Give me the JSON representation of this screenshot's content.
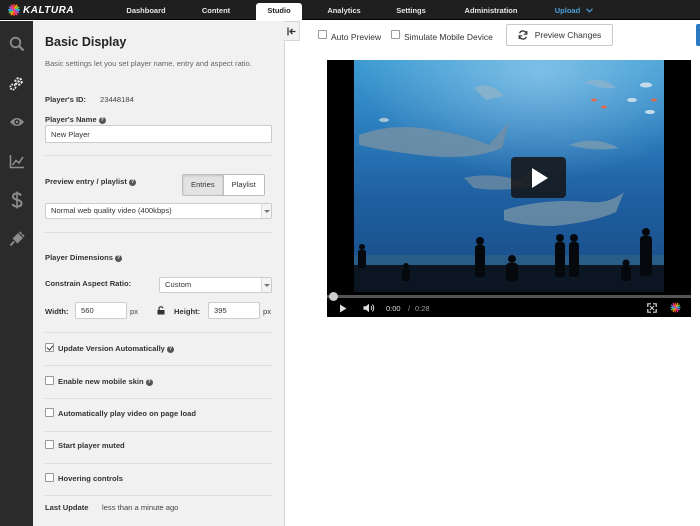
{
  "app": {
    "brand": "KALTURA",
    "logo_colors": [
      "#e63c2f",
      "#f4a100",
      "#7ac142",
      "#27a9e1",
      "#9b59b6",
      "#ee3e80"
    ]
  },
  "nav": {
    "items": [
      {
        "label": "Dashboard"
      },
      {
        "label": "Content"
      },
      {
        "label": "Studio",
        "active": true
      },
      {
        "label": "Analytics"
      },
      {
        "label": "Settings"
      },
      {
        "label": "Administration"
      },
      {
        "label": "Upload",
        "dropdown": true
      }
    ]
  },
  "rail": {
    "icons": [
      "search-icon",
      "gear-icon",
      "eye-icon",
      "chart-icon",
      "dollar-icon",
      "plugin-icon"
    ],
    "active": "gear-icon"
  },
  "panel": {
    "title": "Basic Display",
    "description": "Basic settings let you set player name, entry and aspect ratio.",
    "player_id_label": "Player's ID:",
    "player_id_value": "23448184",
    "player_name_label": "Player's Name",
    "player_name_value": "New Player",
    "preview_entry_label": "Preview entry / playlist",
    "tab_entries": "Entries",
    "tab_playlist": "Playlist",
    "entry_select_value": "Normal web quality video (400kbps)",
    "dimensions_label": "Player Dimensions",
    "aspect_label": "Constrain Aspect Ratio:",
    "aspect_value": "Custom",
    "width_label": "Width:",
    "width_value": "560",
    "height_label": "Height:",
    "height_value": "395",
    "unit": "px",
    "options": [
      {
        "label": "Update Version Automatically",
        "checked": true,
        "help": true
      },
      {
        "label": "Enable new mobile skin",
        "checked": false,
        "help": true
      },
      {
        "label": "Automatically play video on page load",
        "checked": false,
        "help": false
      },
      {
        "label": "Start player muted",
        "checked": false,
        "help": false
      },
      {
        "label": "Hovering controls",
        "checked": false,
        "help": false
      }
    ],
    "last_update_label": "Last Update",
    "last_update_value": "less than a minute ago"
  },
  "preview": {
    "auto_preview_label": "Auto Preview",
    "simulate_mobile_label": "Simulate Mobile Device",
    "preview_changes_label": "Preview Changes",
    "time_current": "0:00",
    "time_separator": "/",
    "time_total": "0:28"
  }
}
